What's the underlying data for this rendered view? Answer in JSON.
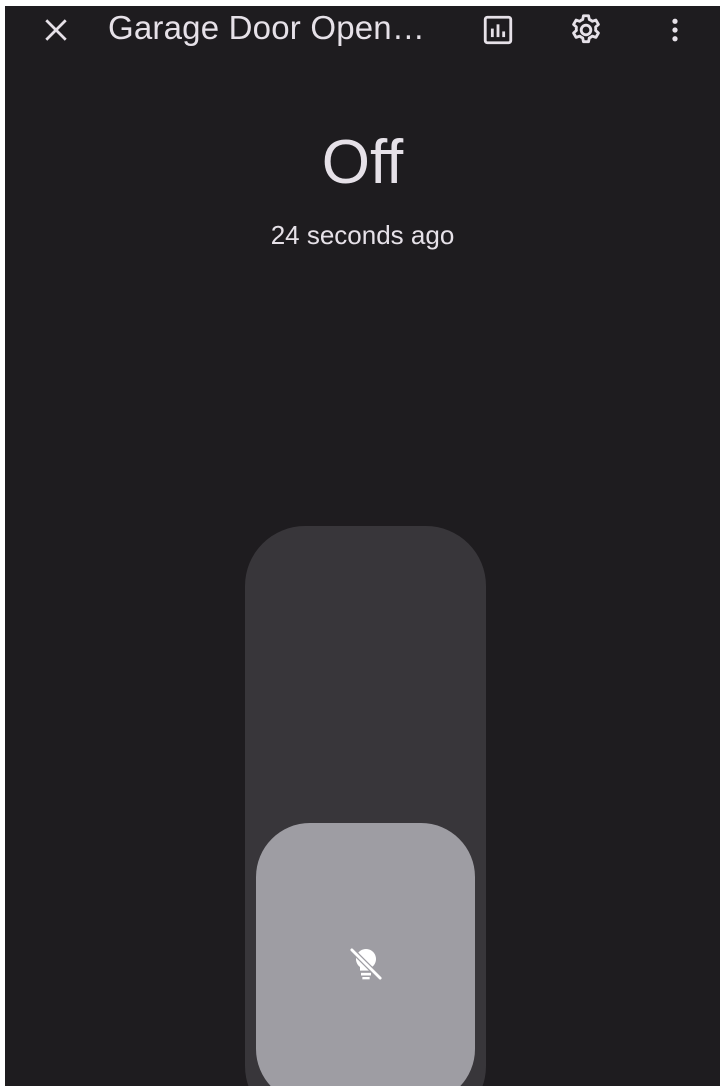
{
  "header": {
    "title": "Garage Door Open…",
    "icons": {
      "close": "close-icon",
      "history": "chart-box-icon",
      "settings": "gear-icon",
      "more": "more-vertical-icon"
    }
  },
  "entity": {
    "state": "Off",
    "last_changed": "24 seconds ago"
  },
  "toggle": {
    "is_on": false,
    "icon": "lightbulb-off-icon"
  },
  "colors": {
    "background": "#1e1c1f",
    "track": "#38363a",
    "knob": "#9e9da3",
    "text": "#e6e1e8"
  }
}
